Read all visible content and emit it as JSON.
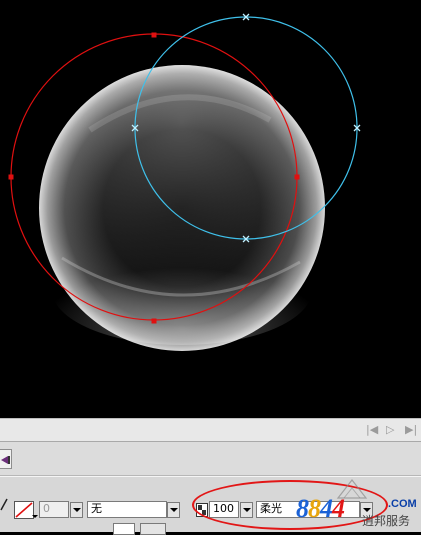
{
  "stroke_width_value": "0",
  "stroke_style_value": "无",
  "opacity_value": "100",
  "blend_mode_value": "柔光",
  "watermark": {
    "number": "8844",
    "domain": ".COM",
    "tagline": "逍邦服务"
  },
  "colors": {
    "canvas_bg": "#000000",
    "red_path": "#e01010",
    "blue_path": "#3fc0ea",
    "sphere_glow": "#c8c8c8",
    "highlight": "#e21616"
  },
  "icons": {
    "stroke_color": "stroke-color-swatch-icon",
    "tool_tab": "brush-tool-icon",
    "opacity": "opacity-icon"
  }
}
